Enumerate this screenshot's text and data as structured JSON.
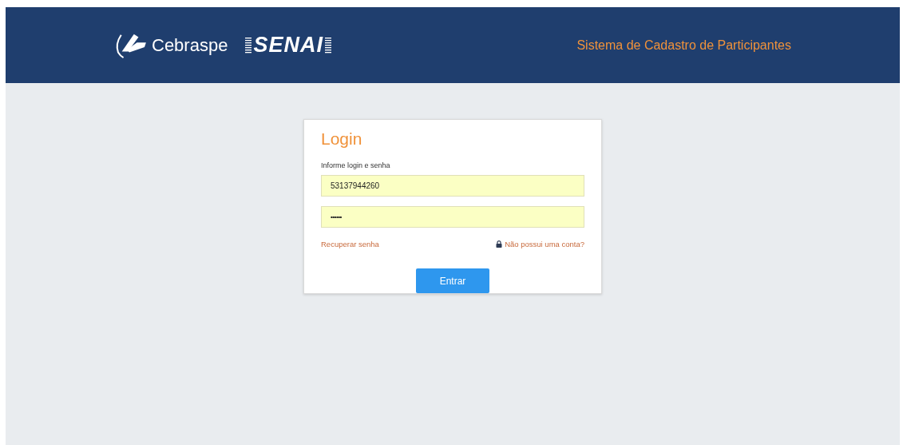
{
  "header": {
    "logos": [
      "Cebraspe",
      "SENAI"
    ],
    "title": "Sistema de Cadastro de Participantes"
  },
  "login": {
    "title": "Login",
    "instruction": "Informe login e senha",
    "fields": [
      {
        "kind": "text",
        "value": "53137944260"
      },
      {
        "kind": "password",
        "value": "••••••"
      }
    ],
    "links": [
      "Recuperar senha",
      "Não possui uma conta?"
    ],
    "button": "Entrar"
  }
}
